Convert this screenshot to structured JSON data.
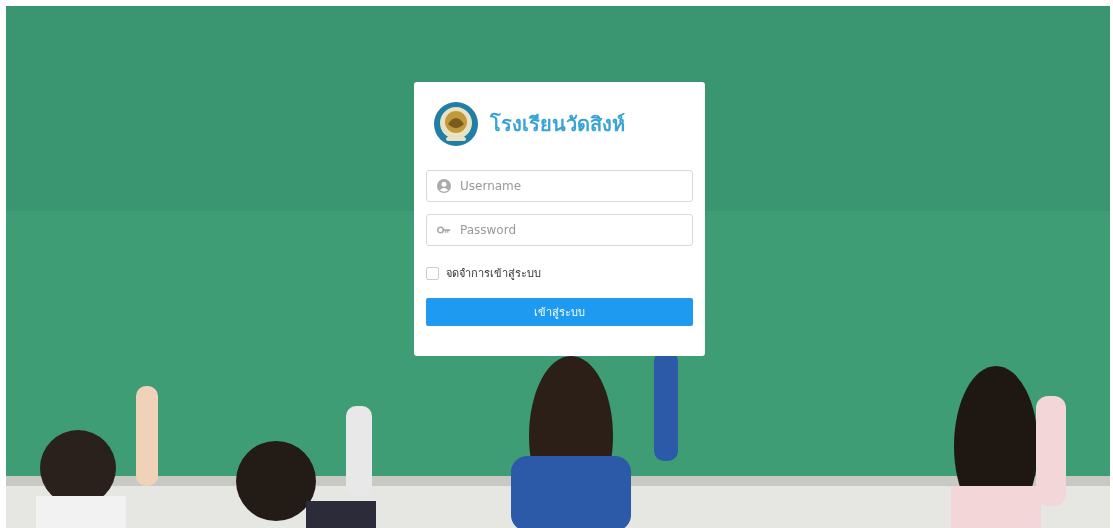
{
  "school": {
    "name": "โรงเรียนวัดสิงห์"
  },
  "fields": [
    {
      "kind": "user",
      "placeholder": "Username"
    },
    {
      "kind": "password",
      "placeholder": "Password"
    }
  ],
  "remember": {
    "label": "จดจำการเข้าสู่ระบบ",
    "checked": false
  },
  "login_button": {
    "label": "เข้าสู่ระบบ"
  }
}
